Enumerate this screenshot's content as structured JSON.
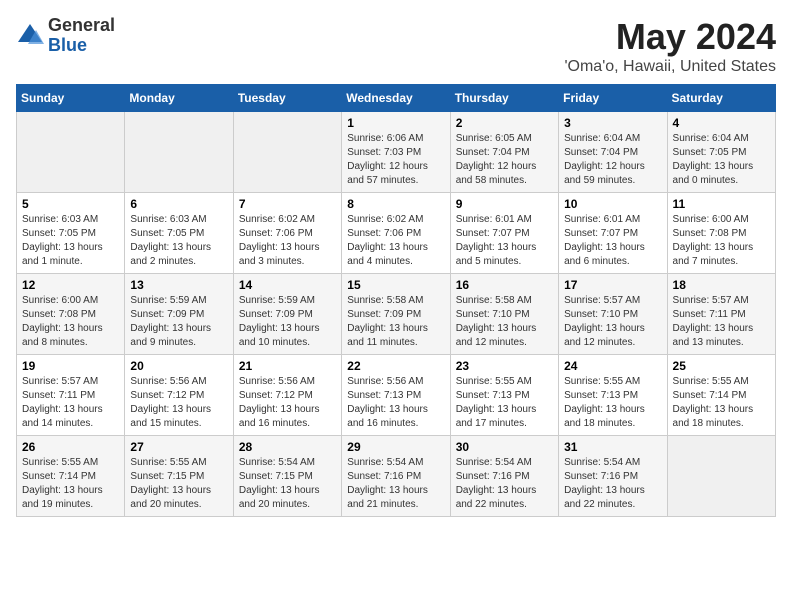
{
  "logo": {
    "general": "General",
    "blue": "Blue"
  },
  "title": "May 2024",
  "subtitle": "'Oma'o, Hawaii, United States",
  "days_of_week": [
    "Sunday",
    "Monday",
    "Tuesday",
    "Wednesday",
    "Thursday",
    "Friday",
    "Saturday"
  ],
  "weeks": [
    [
      {
        "day": "",
        "sunrise": "",
        "sunset": "",
        "daylight": ""
      },
      {
        "day": "",
        "sunrise": "",
        "sunset": "",
        "daylight": ""
      },
      {
        "day": "",
        "sunrise": "",
        "sunset": "",
        "daylight": ""
      },
      {
        "day": "1",
        "sunrise": "Sunrise: 6:06 AM",
        "sunset": "Sunset: 7:03 PM",
        "daylight": "Daylight: 12 hours and 57 minutes."
      },
      {
        "day": "2",
        "sunrise": "Sunrise: 6:05 AM",
        "sunset": "Sunset: 7:04 PM",
        "daylight": "Daylight: 12 hours and 58 minutes."
      },
      {
        "day": "3",
        "sunrise": "Sunrise: 6:04 AM",
        "sunset": "Sunset: 7:04 PM",
        "daylight": "Daylight: 12 hours and 59 minutes."
      },
      {
        "day": "4",
        "sunrise": "Sunrise: 6:04 AM",
        "sunset": "Sunset: 7:05 PM",
        "daylight": "Daylight: 13 hours and 0 minutes."
      }
    ],
    [
      {
        "day": "5",
        "sunrise": "Sunrise: 6:03 AM",
        "sunset": "Sunset: 7:05 PM",
        "daylight": "Daylight: 13 hours and 1 minute."
      },
      {
        "day": "6",
        "sunrise": "Sunrise: 6:03 AM",
        "sunset": "Sunset: 7:05 PM",
        "daylight": "Daylight: 13 hours and 2 minutes."
      },
      {
        "day": "7",
        "sunrise": "Sunrise: 6:02 AM",
        "sunset": "Sunset: 7:06 PM",
        "daylight": "Daylight: 13 hours and 3 minutes."
      },
      {
        "day": "8",
        "sunrise": "Sunrise: 6:02 AM",
        "sunset": "Sunset: 7:06 PM",
        "daylight": "Daylight: 13 hours and 4 minutes."
      },
      {
        "day": "9",
        "sunrise": "Sunrise: 6:01 AM",
        "sunset": "Sunset: 7:07 PM",
        "daylight": "Daylight: 13 hours and 5 minutes."
      },
      {
        "day": "10",
        "sunrise": "Sunrise: 6:01 AM",
        "sunset": "Sunset: 7:07 PM",
        "daylight": "Daylight: 13 hours and 6 minutes."
      },
      {
        "day": "11",
        "sunrise": "Sunrise: 6:00 AM",
        "sunset": "Sunset: 7:08 PM",
        "daylight": "Daylight: 13 hours and 7 minutes."
      }
    ],
    [
      {
        "day": "12",
        "sunrise": "Sunrise: 6:00 AM",
        "sunset": "Sunset: 7:08 PM",
        "daylight": "Daylight: 13 hours and 8 minutes."
      },
      {
        "day": "13",
        "sunrise": "Sunrise: 5:59 AM",
        "sunset": "Sunset: 7:09 PM",
        "daylight": "Daylight: 13 hours and 9 minutes."
      },
      {
        "day": "14",
        "sunrise": "Sunrise: 5:59 AM",
        "sunset": "Sunset: 7:09 PM",
        "daylight": "Daylight: 13 hours and 10 minutes."
      },
      {
        "day": "15",
        "sunrise": "Sunrise: 5:58 AM",
        "sunset": "Sunset: 7:09 PM",
        "daylight": "Daylight: 13 hours and 11 minutes."
      },
      {
        "day": "16",
        "sunrise": "Sunrise: 5:58 AM",
        "sunset": "Sunset: 7:10 PM",
        "daylight": "Daylight: 13 hours and 12 minutes."
      },
      {
        "day": "17",
        "sunrise": "Sunrise: 5:57 AM",
        "sunset": "Sunset: 7:10 PM",
        "daylight": "Daylight: 13 hours and 12 minutes."
      },
      {
        "day": "18",
        "sunrise": "Sunrise: 5:57 AM",
        "sunset": "Sunset: 7:11 PM",
        "daylight": "Daylight: 13 hours and 13 minutes."
      }
    ],
    [
      {
        "day": "19",
        "sunrise": "Sunrise: 5:57 AM",
        "sunset": "Sunset: 7:11 PM",
        "daylight": "Daylight: 13 hours and 14 minutes."
      },
      {
        "day": "20",
        "sunrise": "Sunrise: 5:56 AM",
        "sunset": "Sunset: 7:12 PM",
        "daylight": "Daylight: 13 hours and 15 minutes."
      },
      {
        "day": "21",
        "sunrise": "Sunrise: 5:56 AM",
        "sunset": "Sunset: 7:12 PM",
        "daylight": "Daylight: 13 hours and 16 minutes."
      },
      {
        "day": "22",
        "sunrise": "Sunrise: 5:56 AM",
        "sunset": "Sunset: 7:13 PM",
        "daylight": "Daylight: 13 hours and 16 minutes."
      },
      {
        "day": "23",
        "sunrise": "Sunrise: 5:55 AM",
        "sunset": "Sunset: 7:13 PM",
        "daylight": "Daylight: 13 hours and 17 minutes."
      },
      {
        "day": "24",
        "sunrise": "Sunrise: 5:55 AM",
        "sunset": "Sunset: 7:13 PM",
        "daylight": "Daylight: 13 hours and 18 minutes."
      },
      {
        "day": "25",
        "sunrise": "Sunrise: 5:55 AM",
        "sunset": "Sunset: 7:14 PM",
        "daylight": "Daylight: 13 hours and 18 minutes."
      }
    ],
    [
      {
        "day": "26",
        "sunrise": "Sunrise: 5:55 AM",
        "sunset": "Sunset: 7:14 PM",
        "daylight": "Daylight: 13 hours and 19 minutes."
      },
      {
        "day": "27",
        "sunrise": "Sunrise: 5:55 AM",
        "sunset": "Sunset: 7:15 PM",
        "daylight": "Daylight: 13 hours and 20 minutes."
      },
      {
        "day": "28",
        "sunrise": "Sunrise: 5:54 AM",
        "sunset": "Sunset: 7:15 PM",
        "daylight": "Daylight: 13 hours and 20 minutes."
      },
      {
        "day": "29",
        "sunrise": "Sunrise: 5:54 AM",
        "sunset": "Sunset: 7:16 PM",
        "daylight": "Daylight: 13 hours and 21 minutes."
      },
      {
        "day": "30",
        "sunrise": "Sunrise: 5:54 AM",
        "sunset": "Sunset: 7:16 PM",
        "daylight": "Daylight: 13 hours and 22 minutes."
      },
      {
        "day": "31",
        "sunrise": "Sunrise: 5:54 AM",
        "sunset": "Sunset: 7:16 PM",
        "daylight": "Daylight: 13 hours and 22 minutes."
      },
      {
        "day": "",
        "sunrise": "",
        "sunset": "",
        "daylight": ""
      }
    ]
  ]
}
